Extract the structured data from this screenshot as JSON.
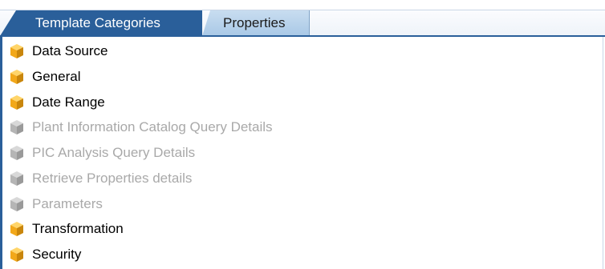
{
  "tabs": [
    {
      "label": "Template Categories",
      "active": true
    },
    {
      "label": "Properties",
      "active": false
    }
  ],
  "colors": {
    "tab_active_bg": "#2a5f9a",
    "tab_inactive_bg": "#b9d3ec",
    "icon_enabled": "#f2a81a",
    "icon_disabled": "#b5b5b5"
  },
  "categories": [
    {
      "label": "Data Source",
      "enabled": true,
      "icon": "category-cube-icon"
    },
    {
      "label": "General",
      "enabled": true,
      "icon": "category-cube-icon"
    },
    {
      "label": "Date Range",
      "enabled": true,
      "icon": "category-cube-icon"
    },
    {
      "label": "Plant Information Catalog Query Details",
      "enabled": false,
      "icon": "category-cube-icon"
    },
    {
      "label": "PIC Analysis Query Details",
      "enabled": false,
      "icon": "category-cube-icon"
    },
    {
      "label": "Retrieve Properties details",
      "enabled": false,
      "icon": "category-cube-icon"
    },
    {
      "label": "Parameters",
      "enabled": false,
      "icon": "category-cube-icon"
    },
    {
      "label": "Transformation",
      "enabled": true,
      "icon": "category-cube-icon"
    },
    {
      "label": "Security",
      "enabled": true,
      "icon": "category-cube-icon"
    }
  ]
}
